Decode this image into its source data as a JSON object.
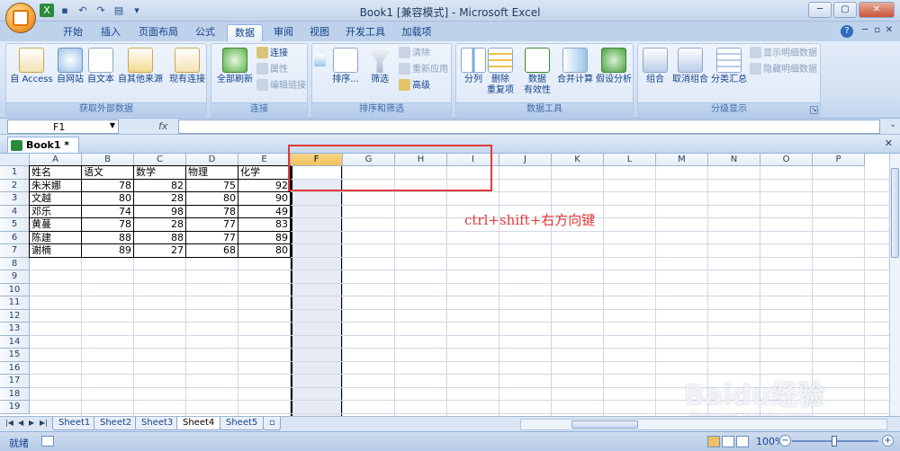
{
  "window": {
    "title": "Book1  [兼容模式] - Microsoft Excel"
  },
  "tabs": [
    {
      "label": "开始"
    },
    {
      "label": "插入"
    },
    {
      "label": "页面布局"
    },
    {
      "label": "公式"
    },
    {
      "label": "数据"
    },
    {
      "label": "审阅"
    },
    {
      "label": "视图"
    },
    {
      "label": "开发工具"
    },
    {
      "label": "加载项"
    }
  ],
  "active_tab": "数据",
  "ribbon": {
    "external": {
      "label": "获取外部数据",
      "access": "自 Access",
      "web": "自网站",
      "text": "自文本",
      "other": "自其他来源",
      "existing": "现有连接"
    },
    "connections": {
      "label": "连接",
      "refresh": "全部刷新",
      "connect": "连接",
      "props": "属性",
      "edit_links": "编辑链接"
    },
    "sort": {
      "label": "排序和筛选",
      "sort": "排序...",
      "filter": "筛选",
      "clear": "清除",
      "reapply": "重新应用",
      "advanced": "高级"
    },
    "tools": {
      "label": "数据工具",
      "split": "分列",
      "dedupe_1": "删除",
      "dedupe_2": "重复项",
      "valid_1": "数据",
      "valid_2": "有效性",
      "consolidate": "合并计算",
      "whatif": "假设分析"
    },
    "outline": {
      "label": "分级显示",
      "group": "组合",
      "ungroup": "取消组合",
      "subtotal": "分类汇总",
      "show_detail": "显示明细数据",
      "hide_detail": "隐藏明细数据"
    }
  },
  "formula_bar": {
    "name_box": "F1",
    "fx": "fx",
    "formula": ""
  },
  "workbook_tab": "Book1 *",
  "columns": [
    "A",
    "B",
    "C",
    "D",
    "E",
    "F",
    "G",
    "H",
    "I",
    "J",
    "K",
    "L",
    "M",
    "N",
    "O",
    "P"
  ],
  "rows": [
    "1",
    "2",
    "3",
    "4",
    "5",
    "6",
    "7",
    "8",
    "9",
    "10",
    "11",
    "12",
    "13",
    "14",
    "15",
    "16",
    "17",
    "18",
    "19"
  ],
  "table": {
    "headers": [
      "姓名",
      "语文",
      "数学",
      "物理",
      "化学"
    ],
    "rows": [
      [
        "朱米娜",
        "78",
        "82",
        "75",
        "92"
      ],
      [
        "文越",
        "80",
        "28",
        "80",
        "90"
      ],
      [
        "邓乐",
        "74",
        "98",
        "78",
        "49"
      ],
      [
        "黄蔓",
        "78",
        "28",
        "77",
        "83"
      ],
      [
        "陈建",
        "88",
        "88",
        "77",
        "89"
      ],
      [
        "谢楠",
        "89",
        "27",
        "68",
        "80"
      ]
    ]
  },
  "annotation": "ctrl+shift+右方向键",
  "sheets": [
    {
      "label": "Sheet1"
    },
    {
      "label": "Sheet2"
    },
    {
      "label": "Sheet3"
    },
    {
      "label": "Sheet4"
    },
    {
      "label": "Sheet5"
    }
  ],
  "active_sheet": "Sheet4",
  "status": {
    "text": "就绪",
    "zoom": "100%"
  },
  "watermark": {
    "brand": "Baidu经验",
    "url": "jingyan.baidu.com"
  },
  "colors": {
    "accent": "#15428b",
    "annotation": "#e03a3a",
    "ribbon_bg": "#dbe6f4"
  }
}
